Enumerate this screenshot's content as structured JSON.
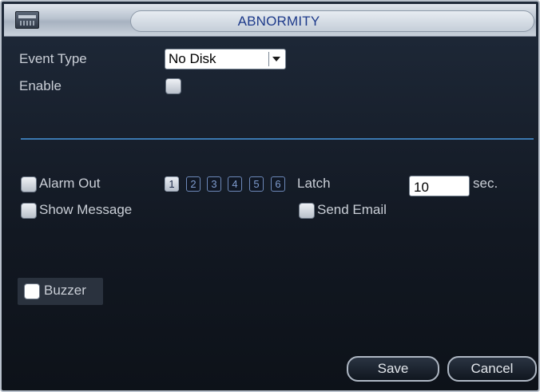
{
  "window": {
    "title": "ABNORMITY"
  },
  "form": {
    "event_type_label": "Event Type",
    "event_type_value": "No Disk",
    "enable_label": "Enable",
    "alarm_out_label": "Alarm Out",
    "alarm_channels": [
      "1",
      "2",
      "3",
      "4",
      "5",
      "6"
    ],
    "alarm_channel_selected": "1",
    "latch_label": "Latch",
    "latch_value": "10",
    "latch_unit": "sec.",
    "show_message_label": "Show Message",
    "send_email_label": "Send Email",
    "buzzer_label": "Buzzer"
  },
  "buttons": {
    "save": "Save",
    "cancel": "Cancel"
  },
  "colors": {
    "background": "#121822",
    "title_text": "#1d3a8a",
    "label_text": "#c9ced6",
    "divider": "#3b78b0",
    "channel_outline": "#6d89b9"
  },
  "icons": {
    "title": "dvr-device-icon",
    "dropdown": "chevron-down-icon"
  }
}
